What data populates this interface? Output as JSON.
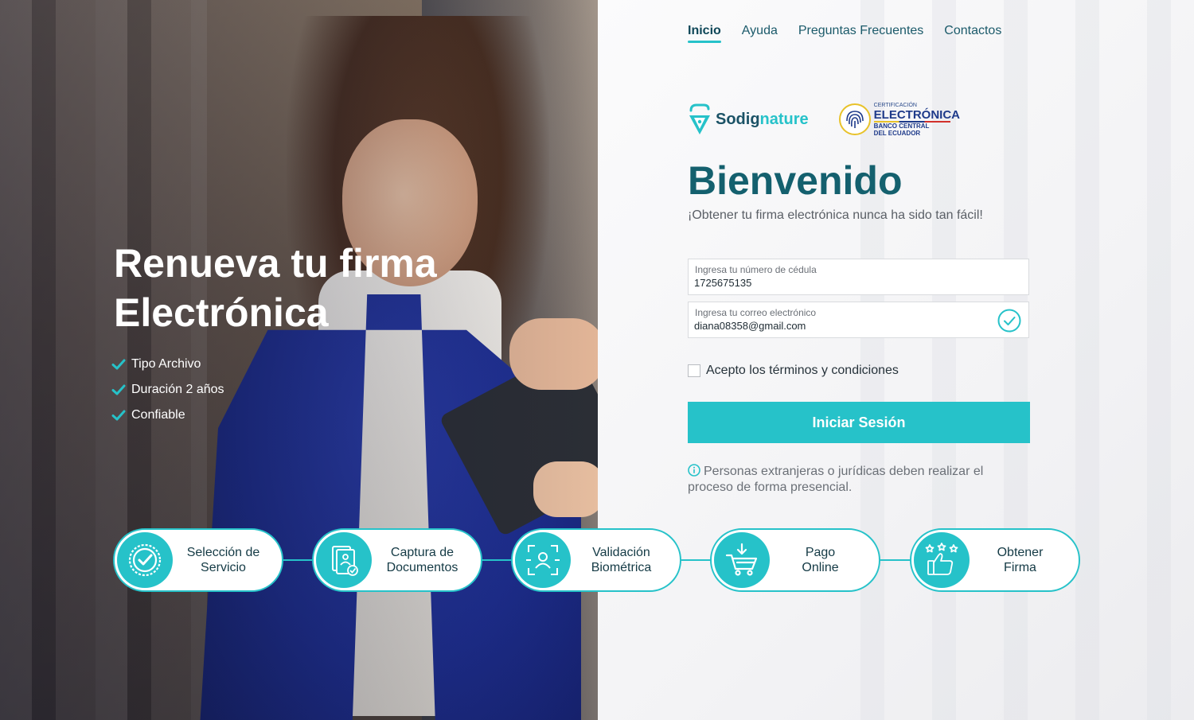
{
  "nav": {
    "items": [
      {
        "label": "Inicio",
        "active": true
      },
      {
        "label": "Ayuda"
      },
      {
        "label": "Preguntas Frecuentes"
      },
      {
        "label": "Contactos"
      }
    ]
  },
  "hero": {
    "title_line1": "Renueva tu firma",
    "title_line2": "Electrónica",
    "features": [
      "Tipo Archivo",
      "Duración 2 años",
      "Confiable"
    ]
  },
  "logos": {
    "sodignature": {
      "part1": "Sodig",
      "part2": "nature"
    },
    "bce": {
      "line1": "CERTIFICACIÓN",
      "line2": "ELECTRÓNICA",
      "line3": "BANCO CENTRAL",
      "line4": "DEL ECUADOR"
    }
  },
  "welcome": {
    "title": "Bienvenido",
    "subtitle": "¡Obtener tu firma electrónica nunca ha sido tan fácil!"
  },
  "form": {
    "cedula": {
      "label": "Ingresa tu número de cédula",
      "value": "1725675135"
    },
    "email": {
      "label": "Ingresa tu correo electrónico",
      "value": "diana08358@gmail.com",
      "valid": true
    },
    "terms_label": "Acepto los términos y condiciones",
    "terms_checked": false,
    "submit_label": "Iniciar Sesión",
    "notice": "Personas extranjeras o jurídicas deben realizar el proceso de forma presencial."
  },
  "steps": [
    {
      "line1": "Selección de",
      "line2": "Servicio",
      "icon": "badge-check-icon"
    },
    {
      "line1": "Captura de",
      "line2": "Documentos",
      "icon": "document-capture-icon"
    },
    {
      "line1": "Validación",
      "line2": "Biométrica",
      "icon": "face-scan-icon"
    },
    {
      "line1": "Pago",
      "line2": "Online",
      "icon": "cart-icon"
    },
    {
      "line1": "Obtener",
      "line2": "Firma",
      "icon": "thumbs-up-stars-icon"
    }
  ],
  "colors": {
    "accent": "#26c2c9",
    "heading": "#14606e",
    "jacket": "#1d2d8e"
  }
}
